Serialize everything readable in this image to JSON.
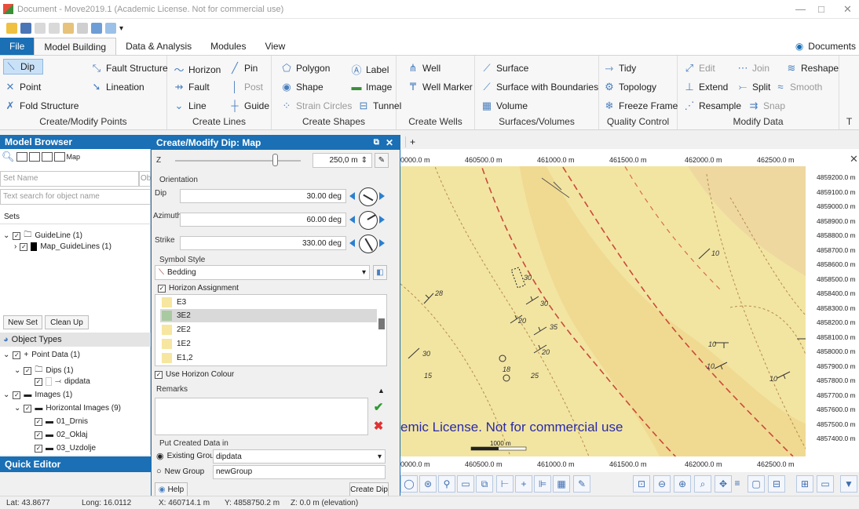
{
  "window": {
    "title": "Document - Move2019.1 (Academic License. Not for commercial use)"
  },
  "menu": {
    "file": "File",
    "tabs": [
      "Model Building",
      "Data & Analysis",
      "Modules",
      "View"
    ],
    "documents": "Documents"
  },
  "ribbon": {
    "create_points": {
      "label": "Create/Modify Points",
      "dip": "Dip",
      "point": "Point",
      "fold_structure": "Fold Structure",
      "fault_structure": "Fault Structure",
      "lineation": "Lineation"
    },
    "create_lines": {
      "label": "Create Lines",
      "horizon": "Horizon",
      "pin": "Pin",
      "fault": "Fault",
      "post": "Post",
      "line": "Line",
      "guide": "Guide"
    },
    "create_shapes": {
      "label": "Create Shapes",
      "polygon": "Polygon",
      "label_item": "Label",
      "shape": "Shape",
      "image": "Image",
      "strain_circles": "Strain Circles",
      "tunnel": "Tunnel"
    },
    "create_wells": {
      "label": "Create Wells",
      "well": "Well",
      "well_marker": "Well Marker"
    },
    "surfaces": {
      "label": "Surfaces/Volumes",
      "surface": "Surface",
      "surface_boundaries": "Surface with Boundaries",
      "volume": "Volume"
    },
    "quality": {
      "label": "Quality Control",
      "tidy": "Tidy",
      "topology": "Topology",
      "freeze_frame": "Freeze Frame"
    },
    "modify": {
      "label": "Modify Data",
      "edit": "Edit",
      "join": "Join",
      "reshape": "Reshape",
      "extend": "Extend",
      "split": "Split",
      "smooth": "Smooth",
      "resample": "Resample",
      "snap": "Snap"
    },
    "cut_label": "T"
  },
  "browser": {
    "title": "Model Browser",
    "map_label": "Map",
    "set_name_placeholder": "Set Name",
    "obj_placeholder": "Ob",
    "search_placeholder": "Text search for object name",
    "sets_label": "Sets",
    "sets": [
      "GuideLine (1)",
      "Map_GuideLines (1)"
    ],
    "new_set": "New Set",
    "clean_up": "Clean Up",
    "object_types": "Object Types",
    "objects": [
      "Point Data (1)",
      "Dips (1)",
      "dipdata",
      "Images (1)",
      "Horizontal Images (9)",
      "01_Drnis",
      "02_Oklaj",
      "03_Uzdolje"
    ]
  },
  "quick_editor": {
    "title": "Quick Editor"
  },
  "dialog": {
    "title": "Create/Modify Dip: Map",
    "z_label": "Z",
    "z_value": "250,0 m",
    "orientation": "Orientation",
    "dip_label": "Dip",
    "dip_value": "30.00 deg",
    "azimuth_label": "Azimuth",
    "azimuth_value": "60.00 deg",
    "strike_label": "Strike",
    "strike_value": "330.00 deg",
    "symbol_style": "Symbol Style",
    "symbol": "Bedding",
    "horizon_assignment": "Horizon Assignment",
    "horizons": [
      "E3",
      "3E2",
      "2E2",
      "1E2",
      "E1,2"
    ],
    "selected_horizon": "3E2",
    "use_horizon_colour": "Use Horizon Colour",
    "remarks": "Remarks",
    "put_created": "Put Created Data in",
    "existing_group": "Existing Group",
    "existing_value": "dipdata",
    "new_group": "New Group",
    "new_group_value": "newGroup",
    "help": "Help",
    "create_dip": "Create Dip"
  },
  "map": {
    "tab_plus": "+",
    "x_ticks_top": [
      "0000.0 m",
      "460500.0 m",
      "461000.0 m",
      "461500.0 m",
      "462000.0 m",
      "462500.0 m"
    ],
    "x_ticks_bottom": [
      "0000.0 m",
      "460500.0 m",
      "461000.0 m",
      "461500.0 m",
      "462000.0 m",
      "462500.0 m"
    ],
    "y_ticks": [
      "4859200.0 m",
      "4859100.0 m",
      "4859000.0 m",
      "4858900.0 m",
      "4858800.0 m",
      "4858700.0 m",
      "4858600.0 m",
      "4858500.0 m",
      "4858400.0 m",
      "4858300.0 m",
      "4858200.0 m",
      "4858100.0 m",
      "4858000.0 m",
      "4857900.0 m",
      "4857800.0 m",
      "4857700.0 m",
      "4857600.0 m",
      "4857500.0 m",
      "4857400.0 m"
    ],
    "watermark": "emic License. Not for commercial use",
    "scale": "1000 m",
    "dip_labels": [
      "28",
      "30",
      "30",
      "20",
      "35",
      "20",
      "30",
      "15",
      "18",
      "25",
      "10",
      "10",
      "10",
      "10"
    ]
  },
  "status": {
    "lat": "Lat: 43.8677",
    "long": "Long: 16.0112",
    "x": "X: 460714.1 m",
    "y": "Y: 4858750.2 m",
    "z": "Z: 0.0 m (elevation)"
  }
}
